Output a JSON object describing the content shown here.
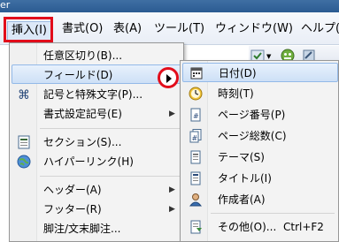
{
  "window": {
    "title_fragment": "er"
  },
  "menubar": {
    "items": [
      {
        "label": "挿入(I)",
        "active": true
      },
      {
        "label": "書式(O)"
      },
      {
        "label": "表(A)"
      },
      {
        "label": "ツール(T)"
      },
      {
        "label": "ウィンドウ(W)"
      },
      {
        "label": "ヘルプ(H)"
      }
    ]
  },
  "insert_menu": {
    "items": [
      {
        "label": "任意区切り(B)...",
        "icon": null
      },
      {
        "label": "フィールド(D)",
        "icon": null,
        "submenu": true,
        "highlighted": true
      },
      {
        "label": "記号と特殊文字(P)...",
        "icon": "special-character-icon"
      },
      {
        "label": "書式設定記号(E)",
        "icon": null,
        "submenu": true
      },
      {
        "label": "セクション(S)...",
        "icon": "section-icon"
      },
      {
        "label": "ハイパーリンク(H)",
        "icon": "hyperlink-globe-icon"
      },
      {
        "label": "ヘッダー(A)",
        "icon": null,
        "submenu": true
      },
      {
        "label": "フッター(R)",
        "icon": null,
        "submenu": true
      },
      {
        "label": "脚注/文末脚注...",
        "icon": null
      }
    ]
  },
  "field_submenu": {
    "items": [
      {
        "label": "日付(D)",
        "icon": "calendar-icon",
        "highlighted": true
      },
      {
        "label": "時刻(T)",
        "icon": "clock-icon"
      },
      {
        "label": "ページ番号(P)",
        "icon": "page-number-icon"
      },
      {
        "label": "ページ総数(C)",
        "icon": "page-count-icon"
      },
      {
        "label": "テーマ(S)",
        "icon": "theme-icon"
      },
      {
        "label": "タイトル(I)",
        "icon": "title-icon"
      },
      {
        "label": "作成者(A)",
        "icon": "author-icon"
      },
      {
        "label": "その他(O)...",
        "icon": "more-fields-icon",
        "shortcut": "Ctrl+F2"
      }
    ]
  },
  "colors": {
    "annotation_red": "#e20d1b",
    "highlight_border": "#93b9e8",
    "menu_bg": "#f3f3f3"
  }
}
